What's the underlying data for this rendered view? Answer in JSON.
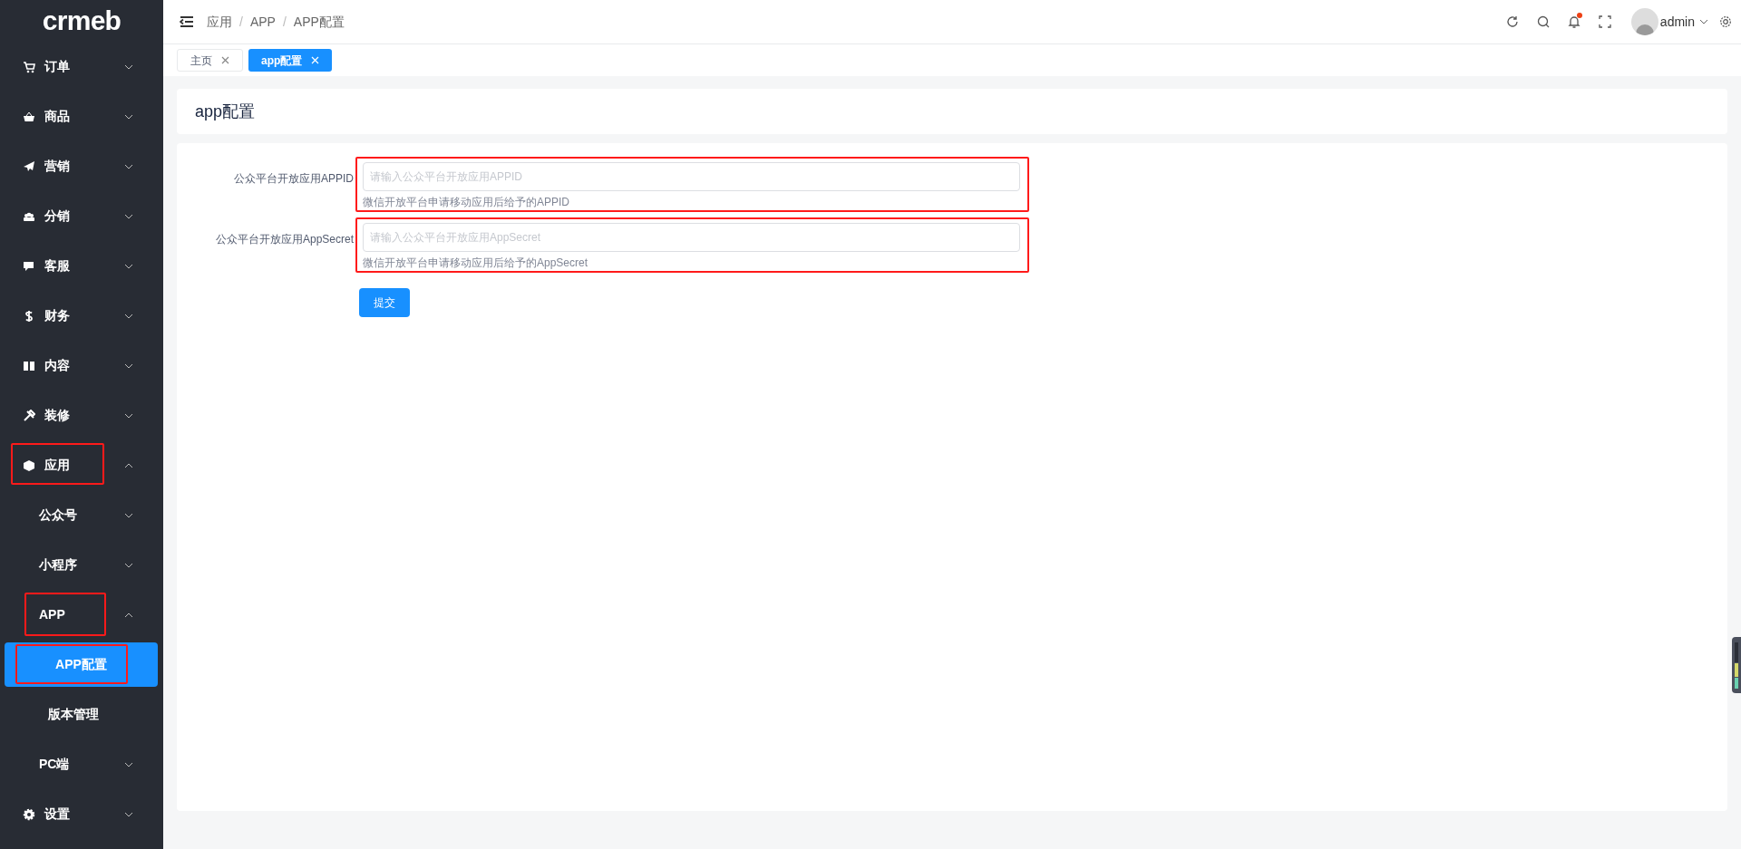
{
  "sidebar": {
    "logo": "crmeb",
    "items": [
      {
        "label": "订单",
        "expanded": false,
        "annotated": false
      },
      {
        "label": "商品",
        "expanded": false,
        "annotated": false
      },
      {
        "label": "营销",
        "expanded": false,
        "annotated": false
      },
      {
        "label": "分销",
        "expanded": false,
        "annotated": false
      },
      {
        "label": "客服",
        "expanded": false,
        "annotated": false
      },
      {
        "label": "财务",
        "expanded": false,
        "annotated": false
      },
      {
        "label": "内容",
        "expanded": false,
        "annotated": false
      },
      {
        "label": "装修",
        "expanded": false,
        "annotated": false
      },
      {
        "label": "应用",
        "expanded": true,
        "annotated": true,
        "children": [
          {
            "label": "公众号",
            "expanded": false,
            "annotated": false
          },
          {
            "label": "小程序",
            "expanded": false,
            "annotated": false
          },
          {
            "label": "APP",
            "expanded": true,
            "annotated": true,
            "children": [
              {
                "label": "APP配置",
                "selected": true,
                "annotated": true
              },
              {
                "label": "版本管理",
                "selected": false,
                "annotated": false
              }
            ]
          },
          {
            "label": "PC端",
            "expanded": false,
            "annotated": false
          }
        ]
      },
      {
        "label": "设置",
        "expanded": false,
        "annotated": false
      }
    ]
  },
  "header": {
    "breadcrumb": [
      "应用",
      "APP",
      "APP配置"
    ],
    "breadcrumb_separator": "/",
    "user": "admin",
    "has_notification": true
  },
  "tabs": [
    {
      "label": "主页",
      "selected": false
    },
    {
      "label": "app配置",
      "selected": true
    }
  ],
  "page_title": "app配置",
  "form": {
    "fields": [
      {
        "label": "公众平台开放应用APPID",
        "placeholder": "请输入公众平台开放应用APPID",
        "hint": "微信开放平台申请移动应用后给予的APPID",
        "annotated": true
      },
      {
        "label": "公众平台开放应用AppSecret",
        "placeholder": "请输入公众平台开放应用AppSecret",
        "hint": "微信开放平台申请移动应用后给予的AppSecret",
        "annotated": true
      }
    ],
    "submit": "提交"
  }
}
